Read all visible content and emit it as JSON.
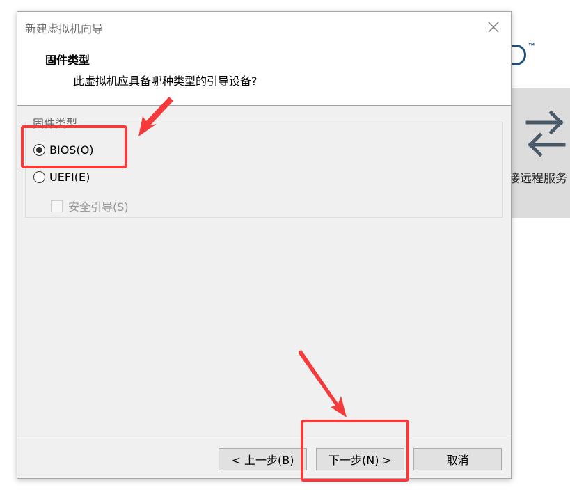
{
  "background_app": {
    "logo_tm": "™",
    "tile_label": "接远程服务"
  },
  "dialog": {
    "title": "新建虚拟机向导",
    "header": {
      "title": "固件类型",
      "subtitle": "此虚拟机应具备哪种类型的引导设备?"
    },
    "group_label": "固件类型",
    "options": [
      {
        "label": "BIOS(O)",
        "selected": true
      },
      {
        "label": "UEFI(E)",
        "selected": false
      }
    ],
    "secure_boot": {
      "label": "安全引导(S)",
      "checked": false,
      "enabled": false
    },
    "buttons": {
      "back": "< 上一步(B)",
      "next": "下一步(N) >",
      "cancel": "取消"
    }
  },
  "annotation_color": "#f43a3a"
}
